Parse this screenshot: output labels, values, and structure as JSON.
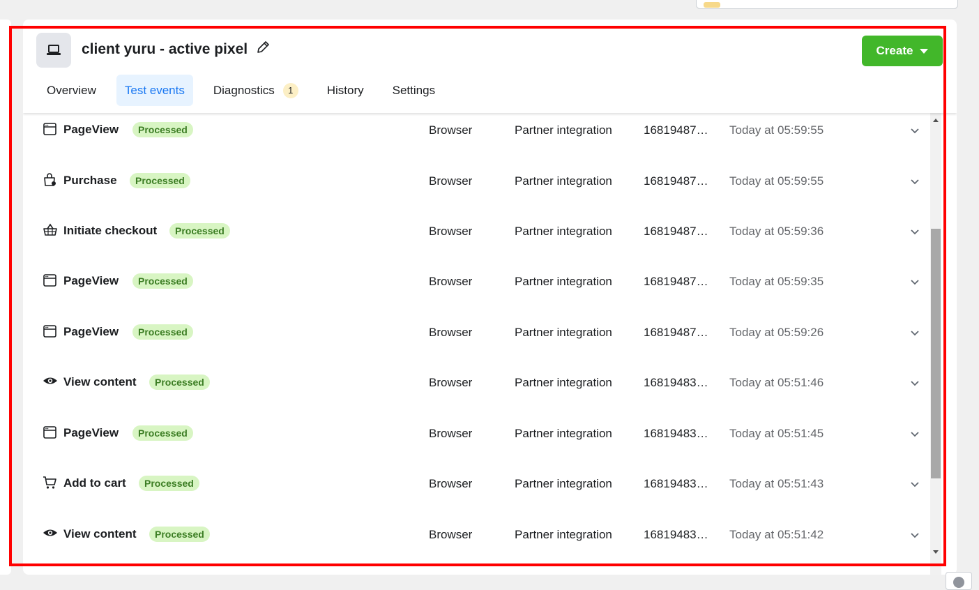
{
  "header": {
    "title": "client yuru - active pixel",
    "create_label": "Create"
  },
  "tabs": [
    {
      "label": "Overview"
    },
    {
      "label": "Test events"
    },
    {
      "label": "Diagnostics",
      "badge": "1"
    },
    {
      "label": "History"
    },
    {
      "label": "Settings"
    }
  ],
  "events": [
    {
      "icon": "browser-window-icon",
      "name": "PageView",
      "status": "Processed",
      "source": "Browser",
      "integration": "Partner integration",
      "id": "168194879…",
      "time": "Today at 05:59:55"
    },
    {
      "icon": "shopping-bag-icon",
      "name": "Purchase",
      "status": "Processed",
      "source": "Browser",
      "integration": "Partner integration",
      "id": "168194879…",
      "time": "Today at 05:59:55"
    },
    {
      "icon": "basket-icon",
      "name": "Initiate checkout",
      "status": "Processed",
      "source": "Browser",
      "integration": "Partner integration",
      "id": "168194877…",
      "time": "Today at 05:59:36"
    },
    {
      "icon": "browser-window-icon",
      "name": "PageView",
      "status": "Processed",
      "source": "Browser",
      "integration": "Partner integration",
      "id": "168194877…",
      "time": "Today at 05:59:35"
    },
    {
      "icon": "browser-window-icon",
      "name": "PageView",
      "status": "Processed",
      "source": "Browser",
      "integration": "Partner integration",
      "id": "168194876…",
      "time": "Today at 05:59:26"
    },
    {
      "icon": "eye-icon",
      "name": "View content",
      "status": "Processed",
      "source": "Browser",
      "integration": "Partner integration",
      "id": "168194830…",
      "time": "Today at 05:51:46"
    },
    {
      "icon": "browser-window-icon",
      "name": "PageView",
      "status": "Processed",
      "source": "Browser",
      "integration": "Partner integration",
      "id": "168194830…",
      "time": "Today at 05:51:45"
    },
    {
      "icon": "cart-icon",
      "name": "Add to cart",
      "status": "Processed",
      "source": "Browser",
      "integration": "Partner integration",
      "id": "168194830…",
      "time": "Today at 05:51:43"
    },
    {
      "icon": "eye-icon",
      "name": "View content",
      "status": "Processed",
      "source": "Browser",
      "integration": "Partner integration",
      "id": "168194830…",
      "time": "Today at 05:51:42"
    }
  ],
  "colors": {
    "accent": "#1877f2",
    "create_button": "#42b72a",
    "status_bg": "#d8f5c3",
    "status_text": "#3b7d23",
    "highlight_border": "#ff0000"
  }
}
